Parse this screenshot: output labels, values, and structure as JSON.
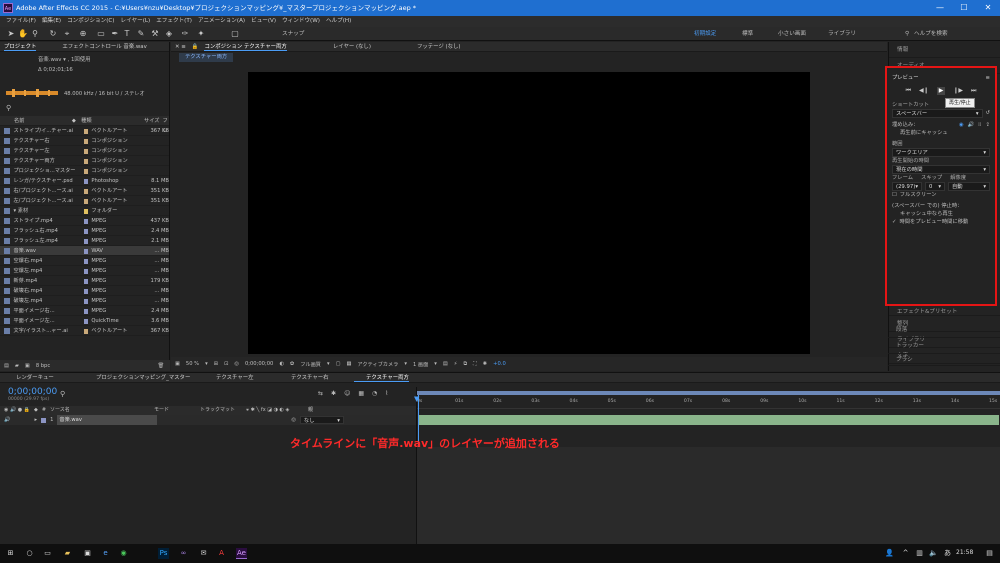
{
  "titlebar": {
    "title": "Adobe After Effects CC 2015 - C:¥Users¥nzu¥Desktop¥プロジェクションマッピング¥_マスタープロジェクションマッピング.aep *",
    "logo": "Ae"
  },
  "menu": [
    "ファイル(F)",
    "編集(E)",
    "コンポジション(C)",
    "レイヤー(L)",
    "エフェクト(T)",
    "アニメーション(A)",
    "ビュー(V)",
    "ウィンドウ(W)",
    "ヘルプ(H)"
  ],
  "toolbar": {
    "snap_label": "スナップ",
    "workspaces": [
      "初期設定",
      "標準",
      "小さい画面",
      "ライブラリ"
    ],
    "help_search": "ヘルプを検索"
  },
  "project": {
    "tabs": [
      "プロジェクト",
      "エフェクトコントロール 音楽.wav"
    ],
    "selected_name": "音楽.wav ▾ , 1回使用",
    "duration": "Δ 0;02;01;16",
    "audio_info": "48.000 kHz / 16 bit U / ステレオ",
    "columns": {
      "name": "名前",
      "type": "種類",
      "size": "サイズ",
      "fr": "フレ"
    },
    "rows": [
      {
        "name": "ストライプ/イ...チャー.ai",
        "type": "ベクトルアート",
        "size": "367 KB",
        "color": "#c9a97a"
      },
      {
        "name": "テクスチャー右",
        "type": "コンポジション",
        "size": "",
        "color": "#c9a97a"
      },
      {
        "name": "テクスチャー左",
        "type": "コンポジション",
        "size": "",
        "color": "#c9a97a"
      },
      {
        "name": "テクスチャー両方",
        "type": "コンポジション",
        "size": "",
        "color": "#c9a97a"
      },
      {
        "name": "プロジェクショ...マスター",
        "type": "コンポジション",
        "size": "",
        "color": "#c9a97a"
      },
      {
        "name": "レンガ/テクスチャー.psd",
        "type": "Photoshop",
        "size": "8.1 MB",
        "color": "#8c95c4"
      },
      {
        "name": "右/プロジェクト...ース.ai",
        "type": "ベクトルアート",
        "size": "351 KB",
        "color": "#c9a97a"
      },
      {
        "name": "左/プロジェクト...ース.ai",
        "type": "ベクトルアート",
        "size": "351 KB",
        "color": "#c9a97a"
      },
      {
        "name": "▾ 素材",
        "type": "フォルダー",
        "size": "",
        "color": "#e0c060"
      },
      {
        "name": "ストライプ.mp4",
        "type": "MPEG",
        "size": "437 KB",
        "color": "#8c95c4"
      },
      {
        "name": "フラッシュ右.mp4",
        "type": "MPEG",
        "size": "2.4 MB",
        "color": "#8c95c4"
      },
      {
        "name": "フラッシュ左.mp4",
        "type": "MPEG",
        "size": "2.1 MB",
        "color": "#8c95c4"
      },
      {
        "name": "音楽.wav",
        "type": "WAV",
        "size": "... MB",
        "color": "#8c95c4",
        "selected": true
      },
      {
        "name": "空爆右.mp4",
        "type": "MPEG",
        "size": "... MB",
        "color": "#8c95c4"
      },
      {
        "name": "空爆左.mp4",
        "type": "MPEG",
        "size": "... MB",
        "color": "#8c95c4"
      },
      {
        "name": "新芽.mp4",
        "type": "MPEG",
        "size": "179 KB",
        "color": "#8c95c4"
      },
      {
        "name": "破壊右.mp4",
        "type": "MPEG",
        "size": "... MB",
        "color": "#8c95c4"
      },
      {
        "name": "破壊左.mp4",
        "type": "MPEG",
        "size": "... MB",
        "color": "#8c95c4"
      },
      {
        "name": "平面イメージ右...",
        "type": "MPEG",
        "size": "2.4 MB",
        "color": "#8c95c4"
      },
      {
        "name": "平面イメージ左...",
        "type": "QuickTime",
        "size": "3.6 MB",
        "color": "#8c95c4"
      },
      {
        "name": "文字/イラスト...ャー.ai",
        "type": "ベクトルアート",
        "size": "367 KB",
        "color": "#c9a97a"
      }
    ],
    "bpc": "8 bpc"
  },
  "comp": {
    "tabs": [
      "コンポジション テクスチャー両方",
      "レイヤー (なし)",
      "フッテージ (なし)"
    ],
    "subtab": "テクスチャー両方",
    "zoom": "50 %",
    "timecode": "0;00;00;00",
    "resolution": "フル画質",
    "camera": "アクティブカメラ",
    "views": "1 画面",
    "exposure": "+0.0"
  },
  "right_panel": {
    "top_items": [
      "情報",
      "オーディオ"
    ],
    "preview": {
      "title": "プレビュー",
      "tooltip": "再生/停止",
      "shortcut_label": "ショートカット",
      "shortcut_value": "スペースバー",
      "include_label": "埋め込み：",
      "cache_before": "再生前にキャッシュ",
      "range_label": "範囲",
      "range_value": "ワークエリア",
      "start_label": "再生開始の時間",
      "start_value": "現在の時間",
      "frame_label": "フレーム",
      "skip_label": "スキップ",
      "resolution_label": "解像度",
      "frame_value": "(29.97)",
      "skip_value": "0",
      "res_value": "自動",
      "fullscreen": "フルスクリーン",
      "stop_label": "(スペースバー での) 停止時：",
      "stop_opt1": "キャッシュ中なら再生",
      "stop_opt2": "時間をプレビュー時間に移動"
    },
    "bottom_items": [
      "エフェクト&プリセット",
      "整列",
      "ライブラリ",
      "文字",
      "段落",
      "トラッカー",
      "ブラシ"
    ]
  },
  "timeline": {
    "tabs": [
      "レンダーキュー",
      "プロジェクションマッピング_マスター",
      "テクスチャー左",
      "テクスチャー右",
      "テクスチャー両方"
    ],
    "timecode": "0;00;00;00",
    "fps": "00000 (29.97 fps)",
    "columns": {
      "source": "ソース名",
      "mode": "モード",
      "trkmat": "トラックマット",
      "parent": "親"
    },
    "layer": {
      "index": "1",
      "name": "音楽.wav",
      "parent": "なし"
    },
    "ticks": [
      "0s",
      "01s",
      "02s",
      "03s",
      "04s",
      "05s",
      "06s",
      "07s",
      "08s",
      "09s",
      "10s",
      "11s",
      "12s",
      "13s",
      "14s",
      "15s"
    ]
  },
  "annotation": "タイムラインに「音声.wav」のレイヤーが追加される",
  "taskbar": {
    "time": "21:58"
  }
}
